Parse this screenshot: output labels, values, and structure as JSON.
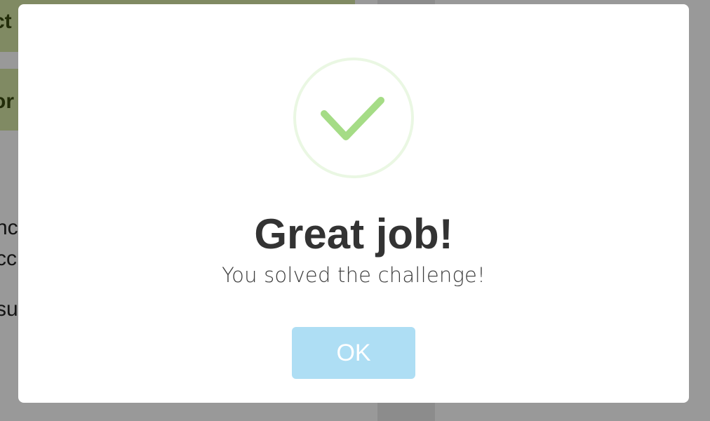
{
  "background": {
    "buttons": [
      {
        "label": "ct"
      },
      {
        "label": "or"
      }
    ],
    "text_lines": [
      "nc",
      "cc",
      "su"
    ]
  },
  "modal": {
    "icon": "check-icon",
    "icon_color": "#a5dc86",
    "icon_ring_color": "#eaf7e3",
    "title": "Great job!",
    "text": "You solved the challenge!",
    "confirm_button": {
      "label": "OK",
      "color": "#aedef4"
    }
  }
}
